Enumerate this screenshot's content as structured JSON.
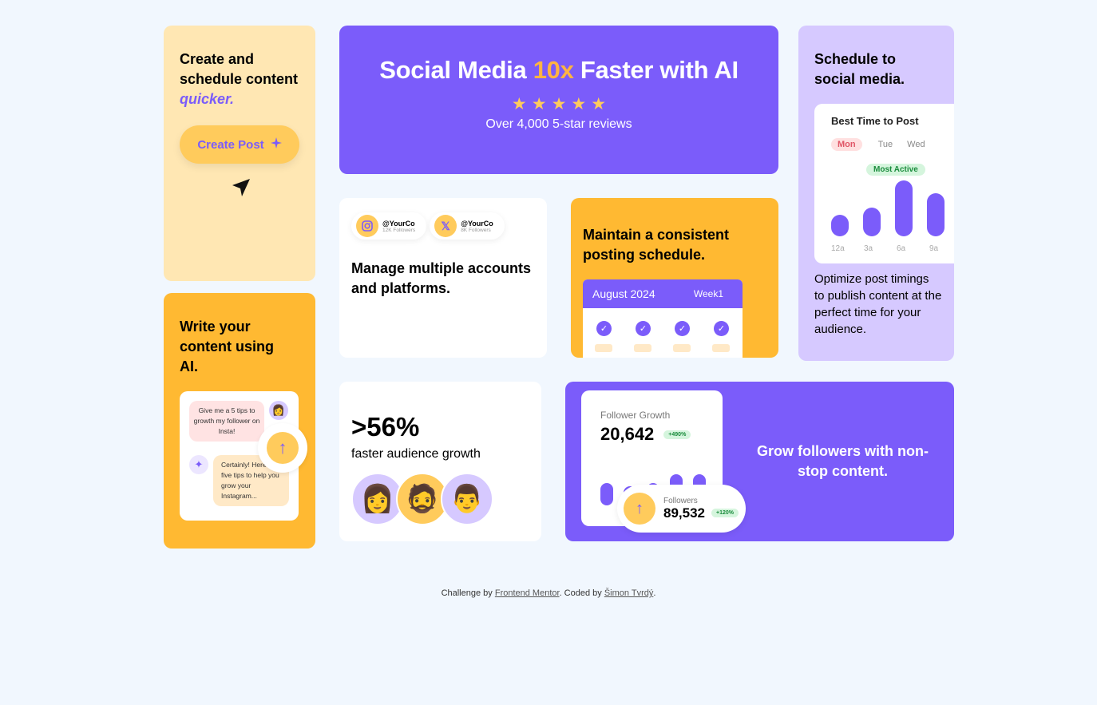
{
  "create_card": {
    "heading": "Create and schedule content",
    "heading_em": "quicker.",
    "button_label": "Create Post",
    "button_icon": "sparkle-icon"
  },
  "hero": {
    "title_before": "Social Media ",
    "title_highlight": "10x",
    "title_after": " Faster with AI",
    "stars": 5,
    "reviews": "Over 4,000 5-star reviews",
    "highlight_color": "#ffb342"
  },
  "schedule_card": {
    "heading": "Schedule to social media.",
    "chart_title": "Best Time to Post",
    "days": [
      "Mon",
      "Tue",
      "Wed"
    ],
    "badge": "Most Active",
    "times": [
      "12a",
      "3a",
      "6a",
      "9a"
    ],
    "bar_values": [
      0.38,
      0.52,
      1.0,
      0.77
    ],
    "description": "Optimize post timings to publish content at the perfect time for your audience."
  },
  "ai_card": {
    "heading": "Write your content using AI.",
    "prompt": "Give me a 5 tips to growth my follower on Insta!",
    "reply": "Certainly! Here are five tips to help you grow your Instagram..."
  },
  "accounts_card": {
    "accounts": [
      {
        "handle": "@YourCo",
        "followers": "12K Followers",
        "icon": "instagram-icon"
      },
      {
        "handle": "@YourCo",
        "followers": "8K Followers",
        "icon": "x-icon"
      }
    ],
    "heading": "Manage multiple accounts and platforms."
  },
  "consistent_card": {
    "heading": "Maintain a consistent posting schedule.",
    "month": "August 2024",
    "week": "Week1"
  },
  "growth_card": {
    "stat": ">56%",
    "label": "faster audience growth"
  },
  "followers_card": {
    "growth_label": "Follower Growth",
    "growth_value": "20,642",
    "growth_pct": "+490%",
    "bar_values": [
      0.6,
      0.53,
      0.6,
      0.85,
      0.85
    ],
    "followers_label": "Followers",
    "followers_value": "89,532",
    "followers_pct": "+120%",
    "text": "Grow followers with non-stop content."
  },
  "footer": {
    "prefix": "Challenge by ",
    "link1": "Frontend Mentor",
    "middle": ". Coded by ",
    "link2": "Šimon Tvrdý",
    "suffix": "."
  },
  "colors": {
    "purple": "#7b5cfa",
    "yellow": "#ffb932",
    "light_yellow": "#ffe7b3",
    "lavender": "#d6c9ff",
    "background": "#f1f7fe"
  }
}
